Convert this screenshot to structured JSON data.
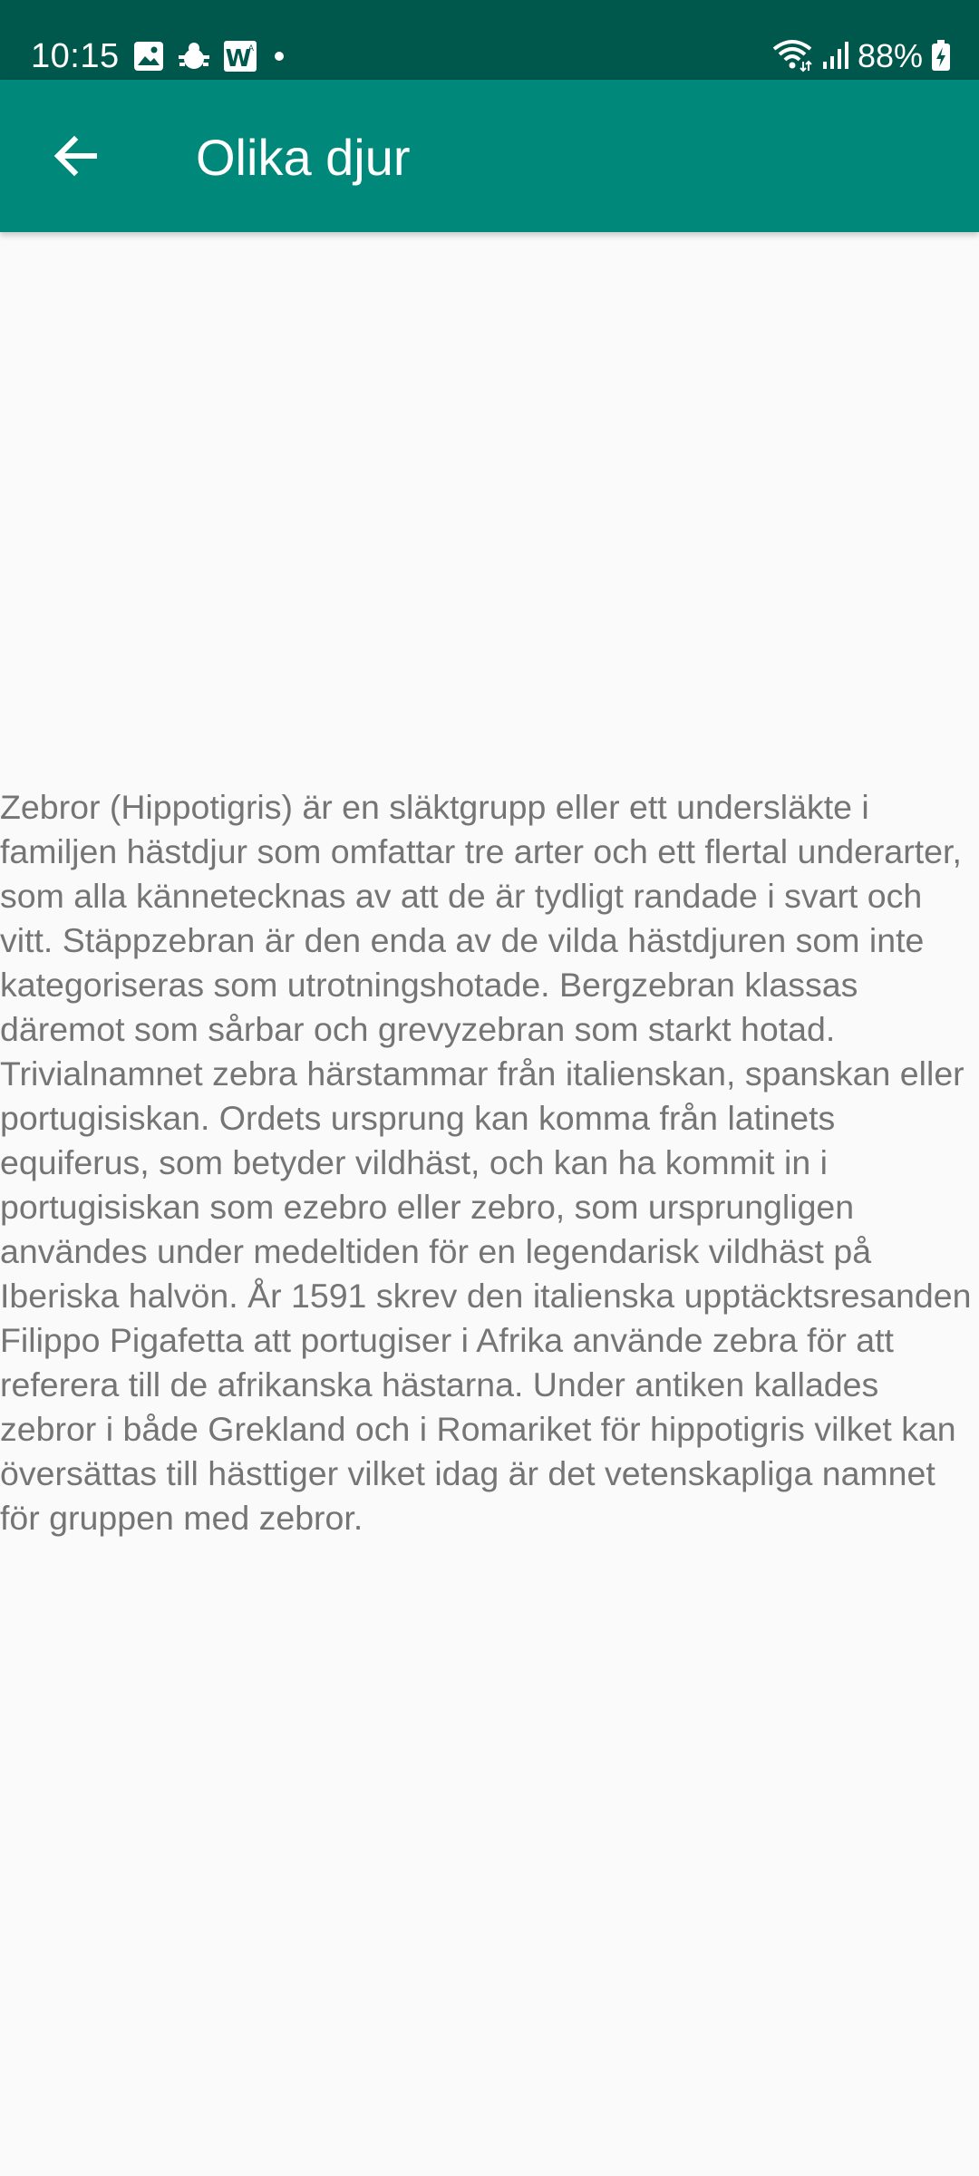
{
  "status_bar": {
    "time": "10:15",
    "battery": "88%",
    "icons": [
      "image-icon",
      "bug-icon",
      "w-app-icon",
      "dot-icon",
      "wifi-icon",
      "signal-icon",
      "battery-charging-icon"
    ]
  },
  "app_bar": {
    "title": "Olika djur",
    "back_icon": "arrow-left-icon"
  },
  "content": {
    "text": "Zebror (Hippotigris) är en släktgrupp eller ett undersläkte i familjen hästdjur som omfattar tre arter och ett flertal underarter, som alla kännetecknas av att de är tydligt randade i svart och vitt. Stäppzebran är den enda av de vilda hästdjuren som inte kategoriseras som utrotningshotade. Bergzebran klassas däremot som sårbar och grevyzebran som starkt hotad. Trivialnamnet zebra härstammar från italienskan, spanskan eller portugisiskan. Ordets ursprung kan komma från latinets equiferus, som betyder vildhäst, och kan ha kommit in i portugisiskan som ezebro eller zebro, som ursprungligen användes under medeltiden för en legendarisk vildhäst på Iberiska halvön. År 1591 skrev den italienska upptäcktsresanden Filippo Pigafetta att portugiser i Afrika använde zebra för att referera till de afrikanska hästarna. Under antiken kallades zebror i både Grekland och i Romariket för hippotigris vilket kan översättas till hästtiger vilket idag är det vetenskapliga namnet för gruppen med zebror."
  },
  "colors": {
    "status_bar": "#00574b",
    "app_bar": "#00897b",
    "background": "#fafafa",
    "text": "#757575"
  }
}
